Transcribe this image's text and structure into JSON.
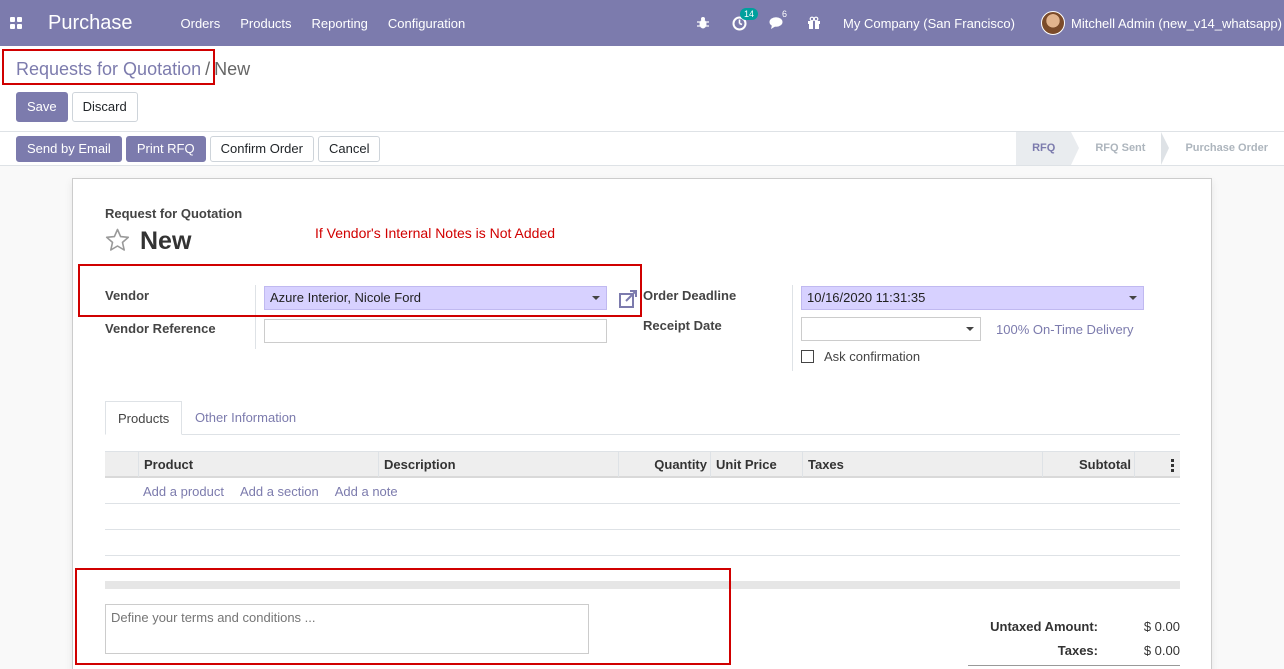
{
  "navbar": {
    "app_name": "Purchase",
    "menu": [
      "Orders",
      "Products",
      "Reporting",
      "Configuration"
    ],
    "activity_count": "14",
    "message_count": "6",
    "company": "My Company (San Francisco)",
    "user": "Mitchell Admin (new_v14_whatsapp)",
    "colors": {
      "navbar": "#7c7bad",
      "badge": "#00a09d"
    }
  },
  "breadcrumb": {
    "parent": "Requests for Quotation",
    "separator": "/",
    "current": "New"
  },
  "buttons": {
    "save": "Save",
    "discard": "Discard"
  },
  "status_actions": {
    "send_email": "Send by Email",
    "print_rfq": "Print RFQ",
    "confirm": "Confirm Order",
    "cancel": "Cancel"
  },
  "stages": [
    "RFQ",
    "RFQ Sent",
    "Purchase Order"
  ],
  "active_stage": "RFQ",
  "form": {
    "doc_label": "Request for Quotation",
    "doc_name": "New",
    "annotation": "If Vendor's Internal Notes is Not Added",
    "vendor_label": "Vendor",
    "vendor_value": "Azure Interior, Nicole Ford",
    "vendor_ref_label": "Vendor Reference",
    "vendor_ref_value": "",
    "order_deadline_label": "Order Deadline",
    "order_deadline_value": "10/16/2020 11:31:35",
    "receipt_date_label": "Receipt Date",
    "receipt_date_value": "",
    "on_time": "100% On-Time Delivery",
    "ask_confirmation": "Ask confirmation"
  },
  "tabs": [
    "Products",
    "Other Information"
  ],
  "lines": {
    "columns": [
      "Product",
      "Description",
      "Quantity",
      "Unit Price",
      "Taxes",
      "Subtotal"
    ],
    "add_links": [
      "Add a product",
      "Add a section",
      "Add a note"
    ]
  },
  "terms_placeholder": "Define your terms and conditions ...",
  "totals": {
    "untaxed_label": "Untaxed Amount:",
    "untaxed_value": "$ 0.00",
    "taxes_label": "Taxes:",
    "taxes_value": "$ 0.00"
  },
  "icons": [
    "apps-grid-icon",
    "bug-icon",
    "activity-clock-icon",
    "chat-icon",
    "gift-icon",
    "star-icon",
    "external-link-icon",
    "dropdown-caret-icon",
    "kebab-menu-icon"
  ]
}
